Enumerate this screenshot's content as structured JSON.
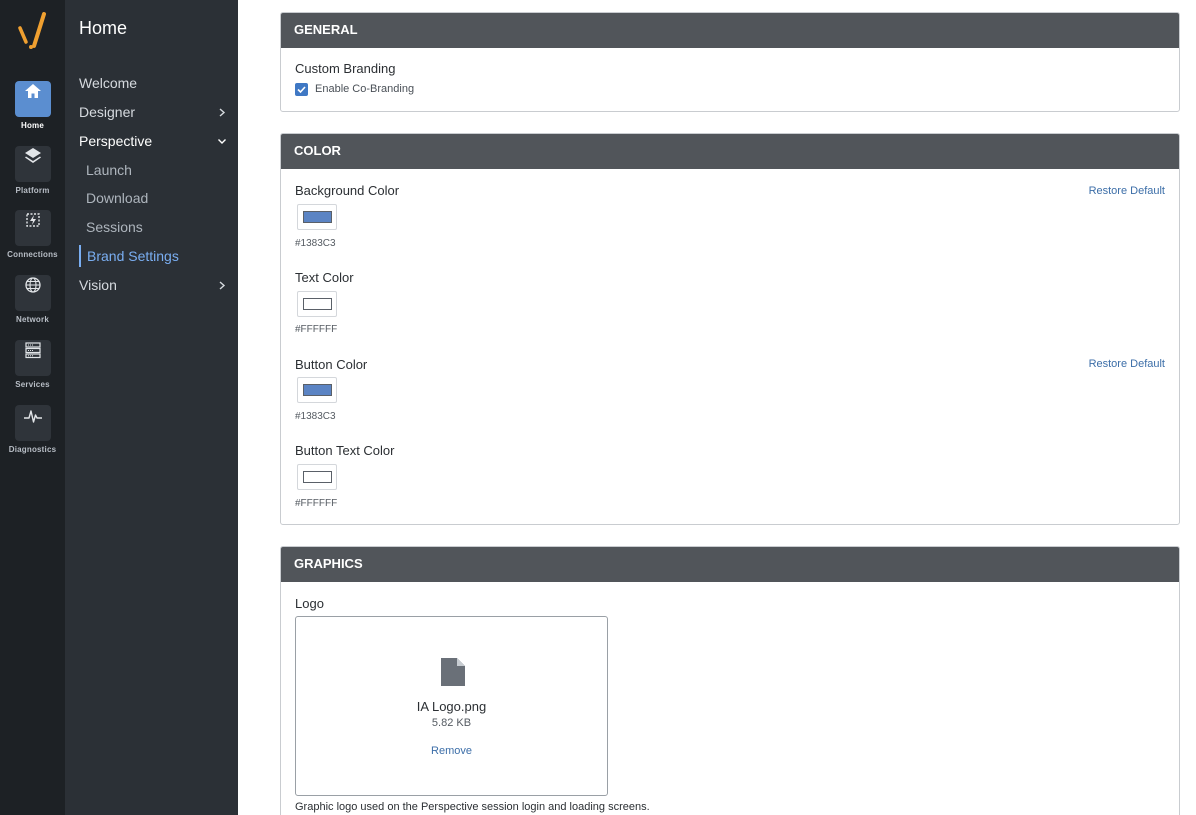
{
  "sidebar_rail": {
    "items": [
      {
        "label": "Home",
        "icon": "home-icon"
      },
      {
        "label": "Platform",
        "icon": "layers-icon"
      },
      {
        "label": "Connections",
        "icon": "connections-icon"
      },
      {
        "label": "Network",
        "icon": "globe-icon"
      },
      {
        "label": "Services",
        "icon": "server-icon"
      },
      {
        "label": "Diagnostics",
        "icon": "pulse-icon"
      }
    ],
    "active": "Home"
  },
  "nav": {
    "title": "Home",
    "items": [
      {
        "label": "Welcome"
      },
      {
        "label": "Designer"
      },
      {
        "label": "Perspective"
      },
      {
        "label": "Launch"
      },
      {
        "label": "Download"
      },
      {
        "label": "Sessions"
      },
      {
        "label": "Brand Settings"
      },
      {
        "label": "Vision"
      }
    ]
  },
  "general": {
    "header": "GENERAL",
    "custom_branding_label": "Custom Branding",
    "enable_cobranding_label": "Enable Co-Branding",
    "enable_cobranding_checked": true
  },
  "color": {
    "header": "COLOR",
    "restore_default_label": "Restore Default",
    "fields": [
      {
        "label": "Background Color",
        "hex": "#1383C3",
        "swatch": "#5b84c4"
      },
      {
        "label": "Text Color",
        "hex": "#FFFFFF",
        "swatch": "#ffffff"
      },
      {
        "label": "Button Color",
        "hex": "#1383C3",
        "swatch": "#5b84c4"
      },
      {
        "label": "Button Text Color",
        "hex": "#FFFFFF",
        "swatch": "#ffffff"
      }
    ]
  },
  "graphics": {
    "header": "GRAPHICS",
    "logo_label": "Logo",
    "file_name": "IA Logo.png",
    "file_size": "5.82 KB",
    "remove_label": "Remove",
    "help_text": "Graphic logo used on the Perspective session login and loading screens."
  },
  "colors": {
    "rail_bg": "#1d2125",
    "nav_bg": "#2b3036",
    "active_rail": "#5b8ed0",
    "active_nav": "#7aaef2",
    "card_header": "#51555a",
    "link": "#3c6ea8"
  }
}
